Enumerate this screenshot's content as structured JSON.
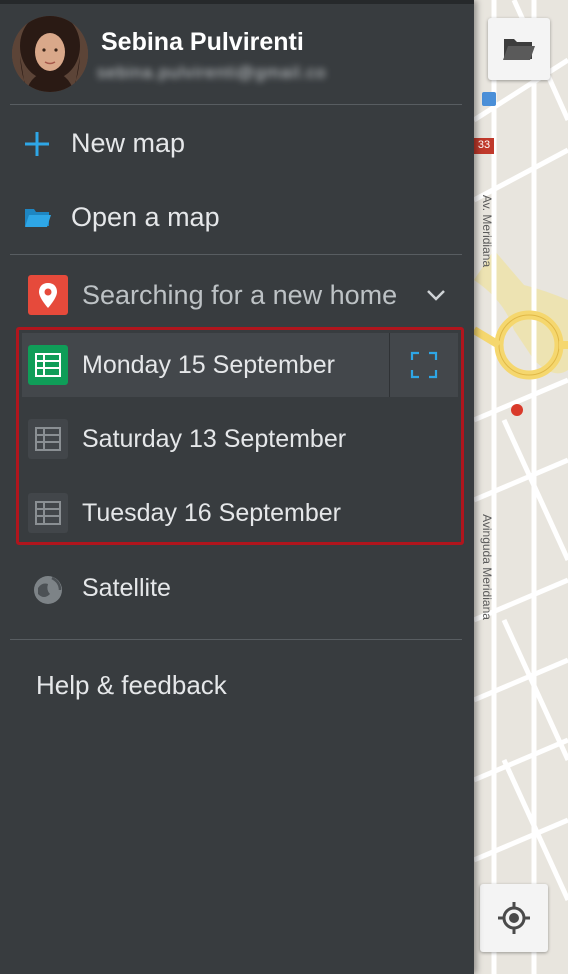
{
  "user": {
    "name": "Sebina Pulvirenti",
    "email": "sebina.pulvirenti@gmail.co"
  },
  "menu": {
    "new_map": "New map",
    "open_map": "Open a map"
  },
  "map_title": "Searching for a new home",
  "layers": [
    {
      "label": "Monday 15 September",
      "active": true
    },
    {
      "label": "Saturday 13 September",
      "active": false
    },
    {
      "label": "Tuesday 16 September",
      "active": false
    }
  ],
  "satellite_label": "Satellite",
  "help_label": "Help & feedback",
  "map": {
    "street_1": "Av. Meridiana",
    "street_2": "Avinguda Meridiana",
    "road_number": "33"
  },
  "colors": {
    "accent_blue": "#2ea6e6",
    "sheet_green": "#0f9d58",
    "pin_red": "#e64a3b",
    "highlight_red": "#b0151d"
  },
  "icons": {
    "new_map": "plus-icon",
    "open_map": "folder-icon",
    "map_pin": "map-pin-icon",
    "sheet": "spreadsheet-icon",
    "expand": "expand-icon",
    "satellite": "satellite-icon",
    "locate": "my-location-icon"
  }
}
